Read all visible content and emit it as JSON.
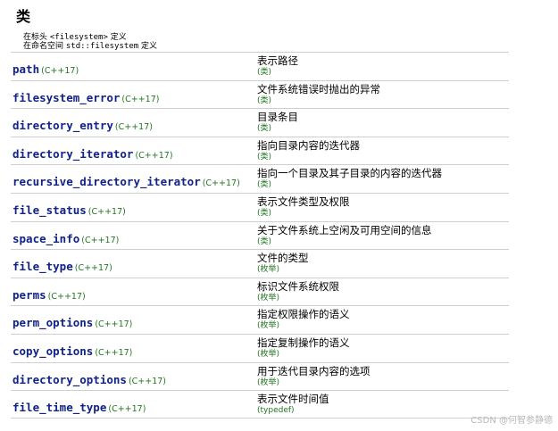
{
  "heading": "类",
  "header_line": {
    "prefix": "在标头 ",
    "code": "<filesystem>",
    "suffix": " 定义"
  },
  "namespace_line": {
    "prefix": "在命名空间 ",
    "code": "std::filesystem",
    "suffix": " 定义"
  },
  "rows": [
    {
      "name": "path",
      "version": "(C++17)",
      "desc": "表示路径",
      "kind": "(类)"
    },
    {
      "name": "filesystem_error",
      "version": "(C++17)",
      "desc": "文件系统错误时抛出的异常",
      "kind": "(类)"
    },
    {
      "name": "directory_entry",
      "version": "(C++17)",
      "desc": "目录条目",
      "kind": "(类)"
    },
    {
      "name": "directory_iterator",
      "version": "(C++17)",
      "desc": "指向目录内容的迭代器",
      "kind": "(类)"
    },
    {
      "name": "recursive_directory_iterator",
      "version": "(C++17)",
      "desc": "指向一个目录及其子目录的内容的迭代器",
      "kind": "(类)"
    },
    {
      "name": "file_status",
      "version": "(C++17)",
      "desc": "表示文件类型及权限",
      "kind": "(类)"
    },
    {
      "name": "space_info",
      "version": "(C++17)",
      "desc": "关于文件系统上空闲及可用空间的信息",
      "kind": "(类)"
    },
    {
      "name": "file_type",
      "version": "(C++17)",
      "desc": "文件的类型",
      "kind": "(枚举)"
    },
    {
      "name": "perms",
      "version": "(C++17)",
      "desc": "标识文件系统权限",
      "kind": "(枚举)"
    },
    {
      "name": "perm_options",
      "version": "(C++17)",
      "desc": "指定权限操作的语义",
      "kind": "(枚举)"
    },
    {
      "name": "copy_options",
      "version": "(C++17)",
      "desc": "指定复制操作的语义",
      "kind": "(枚举)"
    },
    {
      "name": "directory_options",
      "version": "(C++17)",
      "desc": "用于迭代目录内容的选项",
      "kind": "(枚举)"
    },
    {
      "name": "file_time_type",
      "version": "(C++17)",
      "desc": "表示文件时间值",
      "kind": "(typedef)"
    }
  ],
  "watermark": "CSDN @何智参静德",
  "colors": {
    "link": "#112288",
    "version": "#227722",
    "divider": "#cfcfcf"
  }
}
